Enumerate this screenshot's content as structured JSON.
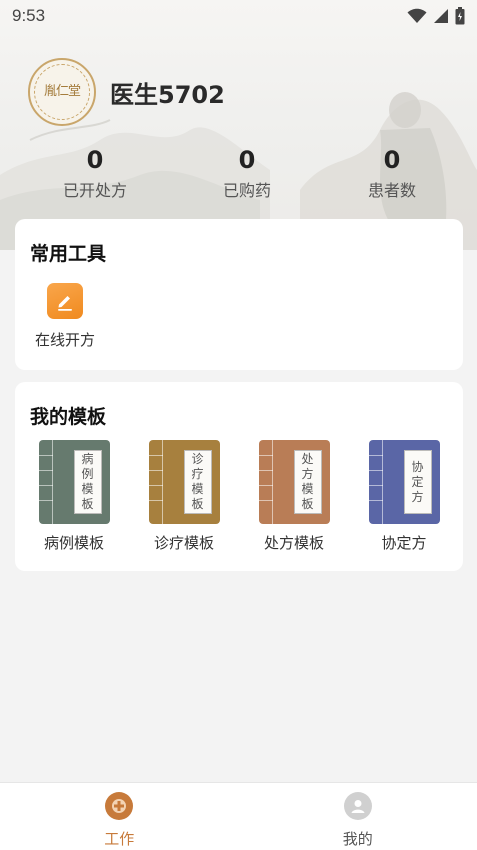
{
  "status_bar": {
    "time": "9:53"
  },
  "profile": {
    "avatar_text": "胤仁堂",
    "name": "医生5702"
  },
  "stats": [
    {
      "value": "0",
      "label": "已开处方"
    },
    {
      "value": "0",
      "label": "已购药"
    },
    {
      "value": "0",
      "label": "患者数"
    }
  ],
  "tools_card": {
    "title": "常用工具",
    "items": [
      {
        "label": "在线开方",
        "icon": "edit-icon"
      }
    ]
  },
  "templates_card": {
    "title": "我的模板",
    "items": [
      {
        "label": "病例模板",
        "cover": "病例模板",
        "color": "#667a6e"
      },
      {
        "label": "诊疗模板",
        "cover": "诊疗模板",
        "color": "#a7803e"
      },
      {
        "label": "处方模板",
        "cover": "处方模板",
        "color": "#b97d56"
      },
      {
        "label": "协定方",
        "cover": "协定方",
        "color": "#5a66a6"
      }
    ]
  },
  "tabbar": {
    "items": [
      {
        "label": "工作",
        "active": true,
        "color": "#c77a3a"
      },
      {
        "label": "我的",
        "active": false,
        "color": "#555555"
      }
    ]
  },
  "colors": {
    "accent": "#f08a1f",
    "page_bg": "#f3f3f3"
  }
}
